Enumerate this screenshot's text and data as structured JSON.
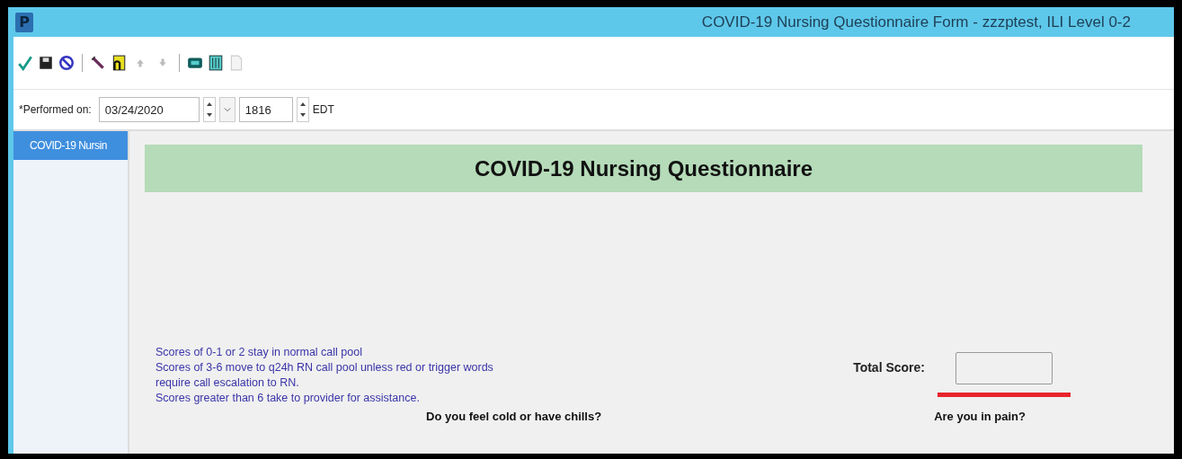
{
  "window": {
    "title": "COVID-19 Nursing Questionnaire Form - zzzptest, ILI Level 0-2",
    "app_icon": "P"
  },
  "performed_on": {
    "label": "*Performed on:",
    "date": "03/24/2020",
    "time": "1816",
    "timezone": "EDT"
  },
  "sidebar": {
    "items": [
      {
        "label": "COVID-19 Nursin",
        "selected": true
      }
    ]
  },
  "form": {
    "heading": "COVID-19 Nursing Questionnaire",
    "instructions": [
      "Scores of 0-1 or 2 stay in normal call pool",
      "Scores of 3-6 move to q24h RN call pool unless red or trigger words",
      "require call escalation to RN.",
      "Scores greater than 6 take to provider for assistance."
    ],
    "total_score": {
      "label": "Total Score:",
      "required": true
    },
    "questions": [
      "Do you feel cold or have chills?",
      "Are you in pain?"
    ]
  }
}
